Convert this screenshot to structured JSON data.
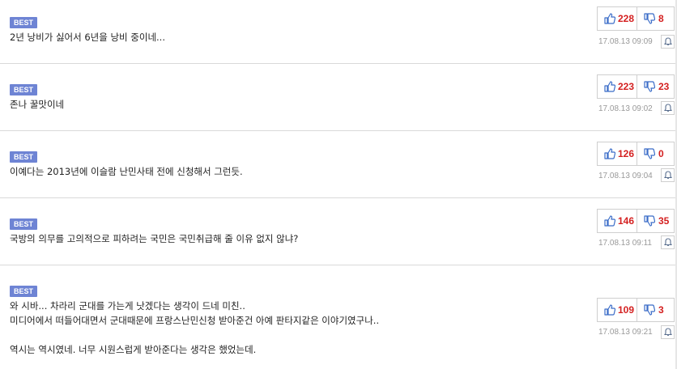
{
  "colors": {
    "best_badge": "#6e84d4",
    "vote_count": "#d42020",
    "thumb_icon": "#3a6cc8",
    "divider": "#d9d9d9",
    "date_text": "#999999"
  },
  "comments": [
    {
      "badge": "BEST",
      "lines": [
        "2년 낭비가 싫어서 6년을 낭비 중이네..."
      ],
      "up": "228",
      "down": "8",
      "date": "17.08.13 09:09"
    },
    {
      "badge": "BEST",
      "lines": [
        "존나 꿀맛이네"
      ],
      "up": "223",
      "down": "23",
      "date": "17.08.13 09:02"
    },
    {
      "badge": "BEST",
      "lines": [
        "이예다는 2013년에 이슬람 난민사태 전에 신청해서 그런듯."
      ],
      "up": "126",
      "down": "0",
      "date": "17.08.13 09:04"
    },
    {
      "badge": "BEST",
      "lines": [
        "국방의 의무를 고의적으로 피하려는 국민은 국민취급해 줄 이유 없지 않냐?"
      ],
      "up": "146",
      "down": "35",
      "date": "17.08.13 09:11"
    },
    {
      "badge": "BEST",
      "lines": [
        "와 시바... 차라리 군대를 가는게 낫겠다는 생각이 드네 미친..",
        "미디어에서 떠들어대면서 군대때문에 프랑스난민신청 받아준건 아예 판타지같은 이야기였구나..",
        "",
        "역시는 역시였네. 너무 시원스럽게 받아준다는 생각은 했었는데."
      ],
      "up": "109",
      "down": "3",
      "date": "17.08.13 09:21"
    }
  ]
}
